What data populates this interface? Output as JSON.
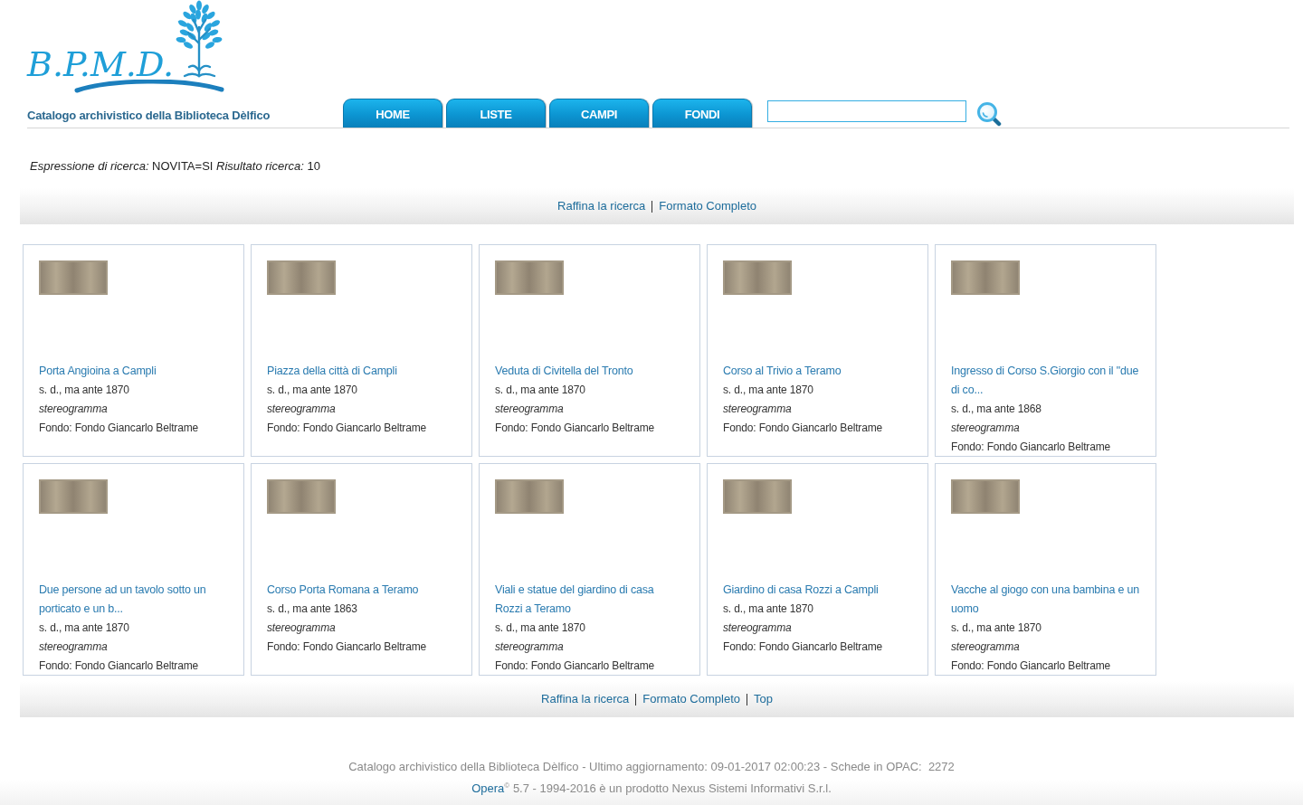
{
  "logo": {
    "text": "B.P.M.D."
  },
  "subtitle": "Catalogo archivistico della Biblioteca Dèlfico",
  "nav_tabs": [
    "HOME",
    "LISTE",
    "CAMPI",
    "FONDI"
  ],
  "summary": "*Espressione di ricerca:* NOVITA=SI *Risultato ricerca:* 10",
  "top_links": [
    "Raffina la ricerca",
    "Formato Completo"
  ],
  "results": [
    {
      "title": "Porta Angioina a Campli",
      "date": "s. d., ma ante 1870",
      "type": "stereogramma",
      "fondo": "Fondo: Fondo Giancarlo Beltrame"
    },
    {
      "title": "Piazza della città di Campli",
      "date": "s. d., ma ante 1870",
      "type": "stereogramma",
      "fondo": "Fondo: Fondo Giancarlo Beltrame"
    },
    {
      "title": "Veduta di Civitella del Tronto",
      "date": "s. d., ma ante 1870",
      "type": "stereogramma",
      "fondo": "Fondo: Fondo Giancarlo Beltrame"
    },
    {
      "title": "Corso al Trivio a Teramo",
      "date": "s. d., ma ante 1870",
      "type": "stereogramma",
      "fondo": "Fondo: Fondo Giancarlo Beltrame"
    },
    {
      "title": "Ingresso di Corso S.Giorgio con il \"due di co...",
      "date": "s. d., ma ante 1868",
      "type": "stereogramma",
      "fondo": "Fondo: Fondo Giancarlo Beltrame"
    },
    {
      "title": "Due persone ad un tavolo sotto un porticato e un b...",
      "date": "s. d., ma ante 1870",
      "type": "stereogramma",
      "fondo": "Fondo: Fondo Giancarlo Beltrame"
    },
    {
      "title": "Corso Porta Romana a Teramo",
      "date": "s. d., ma ante 1863",
      "type": "stereogramma",
      "fondo": "Fondo: Fondo Giancarlo Beltrame"
    },
    {
      "title": "Viali e statue del giardino di casa Rozzi a Teramo",
      "date": "s. d., ma ante 1870",
      "type": "stereogramma",
      "fondo": "Fondo: Fondo Giancarlo Beltrame"
    },
    {
      "title": "Giardino di casa Rozzi a Campli",
      "date": "s. d., ma ante 1870",
      "type": "stereogramma",
      "fondo": "Fondo: Fondo Giancarlo Beltrame"
    },
    {
      "title": "Vacche al giogo con una bambina e un uomo",
      "date": "s. d., ma ante 1870",
      "type": "stereogramma",
      "fondo": "Fondo: Fondo Giancarlo Beltrame"
    }
  ],
  "bottom_links": [
    "Raffina la ricerca",
    "Formato Completo",
    "Top"
  ],
  "footer": {
    "info": "Catalogo archivistico della Biblioteca Dèlfico - Ultimo aggiornamento: 09-01-2017 02:00:23 - Schede in OPAC:  2272",
    "opera_link": "Opera",
    "credit": "$^{©}$ 5.7 - 1994-2016 è un prodotto Nexus Sistemi Informativi S.r.l."
  }
}
